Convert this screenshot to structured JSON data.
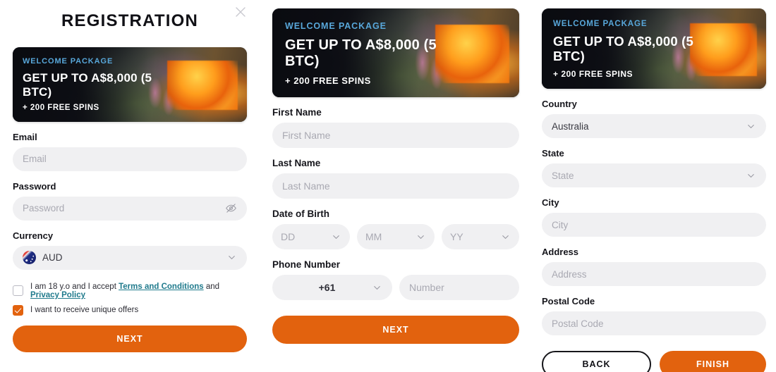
{
  "colors": {
    "accent_orange": "#e2620e",
    "link_teal": "#1f7a8c",
    "banner_kicker_blue": "#58a7da",
    "input_bg": "#f0f0f2",
    "placeholder": "#a9a9b2",
    "text_dark": "#15151b"
  },
  "header": {
    "title": "REGISTRATION",
    "close_icon": "close-icon"
  },
  "promo": {
    "kicker": "WELCOME PACKAGE",
    "headline": "GET UP TO A$8,000 (5 BTC)",
    "subline": "+ 200 FREE SPINS"
  },
  "step1": {
    "email": {
      "label": "Email",
      "placeholder": "Email",
      "value": ""
    },
    "password": {
      "label": "Password",
      "placeholder": "Password",
      "value": "",
      "toggle_icon": "eye-off-icon"
    },
    "currency": {
      "label": "Currency",
      "value": "AUD",
      "flag_icon": "australia-flag-icon",
      "chevron_icon": "chevron-down-icon"
    },
    "terms": {
      "checked": false,
      "text_before": "I am 18 y.o and I accept",
      "link1": "Terms and Conditions",
      "text_middle": "and",
      "link2": "Privacy Policy"
    },
    "offers": {
      "checked": true,
      "text": "I want to receive unique offers"
    },
    "next_label": "NEXT"
  },
  "step2": {
    "first_name": {
      "label": "First Name",
      "placeholder": "First Name",
      "value": ""
    },
    "last_name": {
      "label": "Last Name",
      "placeholder": "Last Name",
      "value": ""
    },
    "dob": {
      "label": "Date of Birth",
      "day": "DD",
      "month": "MM",
      "year": "YY",
      "chevron_icon": "chevron-down-icon"
    },
    "phone": {
      "label": "Phone Number",
      "country_code": "+61",
      "number_placeholder": "Number",
      "number_value": "",
      "chevron_icon": "chevron-down-icon"
    },
    "next_label": "NEXT"
  },
  "step3": {
    "country": {
      "label": "Country",
      "value": "Australia",
      "chevron_icon": "chevron-down-icon"
    },
    "state": {
      "label": "State",
      "placeholder": "State",
      "value": "",
      "chevron_icon": "chevron-down-icon"
    },
    "city": {
      "label": "City",
      "placeholder": "City",
      "value": ""
    },
    "address": {
      "label": "Address",
      "placeholder": "Address",
      "value": ""
    },
    "postal_code": {
      "label": "Postal Code",
      "placeholder": "Postal Code",
      "value": ""
    },
    "back_label": "BACK",
    "finish_label": "FINISH"
  }
}
